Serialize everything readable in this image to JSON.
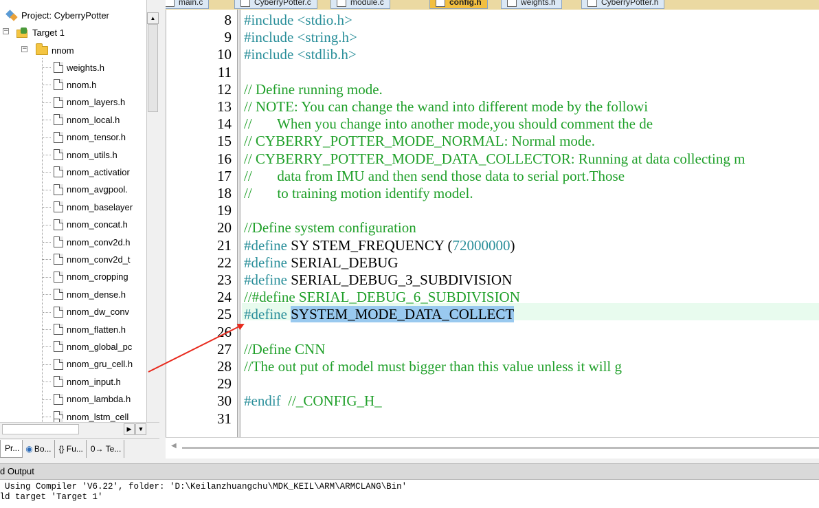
{
  "editor_tabs": [
    "main.c",
    "CyberryPotter.c",
    "module.c",
    "config.h",
    "weights.h",
    "CyberryPotter.h"
  ],
  "active_tab": "config.h",
  "project_tree": {
    "project_label": "Project: CyberryPotter",
    "target_label": "Target 1",
    "folder_label": "nnom",
    "files": [
      "weights.h",
      "nnom.h",
      "nnom_layers.h",
      "nnom_local.h",
      "nnom_tensor.h",
      "nnom_utils.h",
      "nnom_activatior",
      "nnom_avgpool.",
      "nnom_baselayer",
      "nnom_concat.h",
      "nnom_conv2d.h",
      "nnom_conv2d_t",
      "nnom_cropping",
      "nnom_dense.h",
      "nnom_dw_conv",
      "nnom_flatten.h",
      "nnom_global_pc",
      "nnom_gru_cell.h",
      "nnom_input.h",
      "nnom_lambda.h",
      "nnom_lstm_cell"
    ]
  },
  "panel_tabs": [
    {
      "icon": "project-icon",
      "label": "Pr..."
    },
    {
      "icon": "books-icon",
      "label": "Bo..."
    },
    {
      "icon": "functions-icon",
      "label": "{} Fu..."
    },
    {
      "icon": "templates-icon",
      "label": "0→ Te..."
    }
  ],
  "code": [
    {
      "n": "8",
      "parts": [
        [
          "pre",
          "#include "
        ],
        [
          "pre",
          "<stdio.h>"
        ]
      ]
    },
    {
      "n": "9",
      "parts": [
        [
          "pre",
          "#include "
        ],
        [
          "pre",
          "<string.h>"
        ]
      ]
    },
    {
      "n": "10",
      "parts": [
        [
          "pre",
          "#include "
        ],
        [
          "pre",
          "<stdlib.h>"
        ]
      ]
    },
    {
      "n": "11",
      "parts": []
    },
    {
      "n": "12",
      "parts": [
        [
          "cmt",
          "// Define running mode."
        ]
      ]
    },
    {
      "n": "13",
      "parts": [
        [
          "cmt",
          "// NOTE: You can change the wand into different mode by the followi"
        ]
      ]
    },
    {
      "n": "14",
      "parts": [
        [
          "cmt",
          "//       When you change into another mode,you should comment the de"
        ]
      ]
    },
    {
      "n": "15",
      "parts": [
        [
          "cmt",
          "// CYBERRY_POTTER_MODE_NORMAL: Normal mode."
        ]
      ]
    },
    {
      "n": "16",
      "parts": [
        [
          "cmt",
          "// CYBERRY_POTTER_MODE_DATA_COLLECTOR: Running at data collecting m"
        ]
      ]
    },
    {
      "n": "17",
      "parts": [
        [
          "cmt",
          "//       data from IMU and then send those data to serial port.Those"
        ]
      ]
    },
    {
      "n": "18",
      "parts": [
        [
          "cmt",
          "//       to training motion identify model."
        ]
      ]
    },
    {
      "n": "19",
      "parts": []
    },
    {
      "n": "20",
      "parts": [
        [
          "cmt",
          "//Define system configuration"
        ]
      ]
    },
    {
      "n": "21",
      "parts": [
        [
          "pre",
          "#define"
        ],
        [
          "txt",
          " SY STEM_FREQUENCY ("
        ],
        [
          "num",
          "72000000"
        ],
        [
          "txt",
          ")"
        ]
      ]
    },
    {
      "n": "22",
      "parts": [
        [
          "pre",
          "#define"
        ],
        [
          "txt",
          " SERIAL_DEBUG"
        ]
      ]
    },
    {
      "n": "23",
      "parts": [
        [
          "pre",
          "#define"
        ],
        [
          "txt",
          " SERIAL_DEBUG_3_SUBDIVISION"
        ]
      ]
    },
    {
      "n": "24",
      "parts": [
        [
          "cmt",
          "//#define SERIAL_DEBUG_6_SUBDIVISION"
        ]
      ]
    },
    {
      "n": "25",
      "parts": [
        [
          "pre",
          "#define"
        ],
        [
          "txt",
          " "
        ],
        [
          "sel",
          "SYSTEM_MODE_DATA_COLLECT"
        ]
      ]
    },
    {
      "n": "26",
      "parts": []
    },
    {
      "n": "27",
      "parts": [
        [
          "cmt",
          "//Define CNN"
        ]
      ]
    },
    {
      "n": "28",
      "parts": [
        [
          "cmt",
          "//The out put of model must bigger than this value unless it will g"
        ]
      ]
    },
    {
      "n": "29",
      "parts": []
    },
    {
      "n": "30",
      "parts": [
        [
          "pre",
          "#endif"
        ],
        [
          "txt",
          "  "
        ],
        [
          "cmt",
          "//_CONFIG_H_"
        ]
      ]
    },
    {
      "n": "31",
      "parts": []
    }
  ],
  "build_output": {
    "title": "d Output",
    "lines": [
      "* Using Compiler 'V6.22', folder: 'D:\\Keilanzhuangchu\\MDK_KEIL\\ARM\\ARMCLANG\\Bin'",
      "ild target 'Target 1'"
    ]
  },
  "colors": {
    "preprocessor": "#2a8f9a",
    "comment": "#20a02a",
    "selection": "#99c9ef",
    "current_line": "#e8fbee",
    "active_tab": "#f2bf40",
    "annotation_arrow": "#e8291c"
  }
}
